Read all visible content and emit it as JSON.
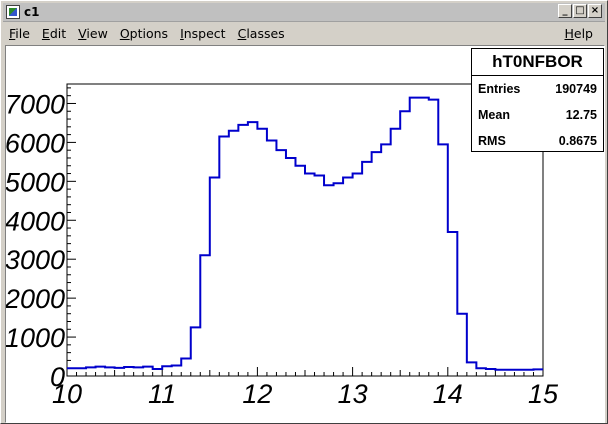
{
  "window": {
    "title": "c1",
    "buttons": {
      "minimize": "_",
      "maximize": "□",
      "close": "×"
    }
  },
  "menu": {
    "items": [
      {
        "label": "File",
        "mnemonic": "F",
        "rest": "ile"
      },
      {
        "label": "Edit",
        "mnemonic": "E",
        "rest": "dit"
      },
      {
        "label": "View",
        "mnemonic": "V",
        "rest": "iew"
      },
      {
        "label": "Options",
        "mnemonic": "O",
        "rest": "ptions"
      },
      {
        "label": "Inspect",
        "mnemonic": "I",
        "rest": "nspect"
      },
      {
        "label": "Classes",
        "mnemonic": "C",
        "rest": "lasses"
      }
    ],
    "help": {
      "label": "Help",
      "mnemonic": "H",
      "rest": "elp"
    }
  },
  "stats": {
    "name": "hT0NFBOR",
    "rows": [
      {
        "label": "Entries",
        "value": "190749"
      },
      {
        "label": "Mean",
        "value": "12.75"
      },
      {
        "label": "RMS",
        "value": "0.8675"
      }
    ]
  },
  "chart_data": {
    "type": "histogram",
    "line_color": "#0000cc",
    "xlim": [
      10,
      15
    ],
    "ylim": [
      0,
      7500
    ],
    "x_ticks": [
      "10",
      "11",
      "12",
      "13",
      "14",
      "15"
    ],
    "y_ticks": [
      "0",
      "1000",
      "2000",
      "3000",
      "4000",
      "5000",
      "6000",
      "7000"
    ],
    "x_tick_values": [
      10,
      11,
      12,
      13,
      14,
      15
    ],
    "y_tick_values": [
      0,
      1000,
      2000,
      3000,
      4000,
      5000,
      6000,
      7000
    ],
    "bin_edges": [
      10,
      10.1,
      10.2,
      10.3,
      10.4,
      10.5,
      10.6,
      10.7,
      10.8,
      10.9,
      11,
      11.1,
      11.2,
      11.3,
      11.4,
      11.5,
      11.6,
      11.7,
      11.8,
      11.9,
      12,
      12.1,
      12.2,
      12.3,
      12.4,
      12.5,
      12.6,
      12.7,
      12.8,
      12.9,
      13,
      13.1,
      13.2,
      13.3,
      13.4,
      13.5,
      13.6,
      13.7,
      13.8,
      13.9,
      14,
      14.1,
      14.2,
      14.3,
      14.4,
      14.5,
      14.6,
      14.7,
      14.8,
      14.9,
      15
    ],
    "values": [
      200,
      200,
      220,
      240,
      220,
      210,
      230,
      220,
      240,
      180,
      250,
      270,
      450,
      1250,
      3100,
      5100,
      6150,
      6300,
      6450,
      6520,
      6350,
      6050,
      5800,
      5600,
      5400,
      5200,
      5150,
      4900,
      4950,
      5100,
      5200,
      5500,
      5750,
      5950,
      6350,
      6800,
      7150,
      7150,
      7100,
      5950,
      3700,
      1600,
      350,
      200,
      180,
      160,
      160,
      160,
      160,
      170
    ]
  }
}
